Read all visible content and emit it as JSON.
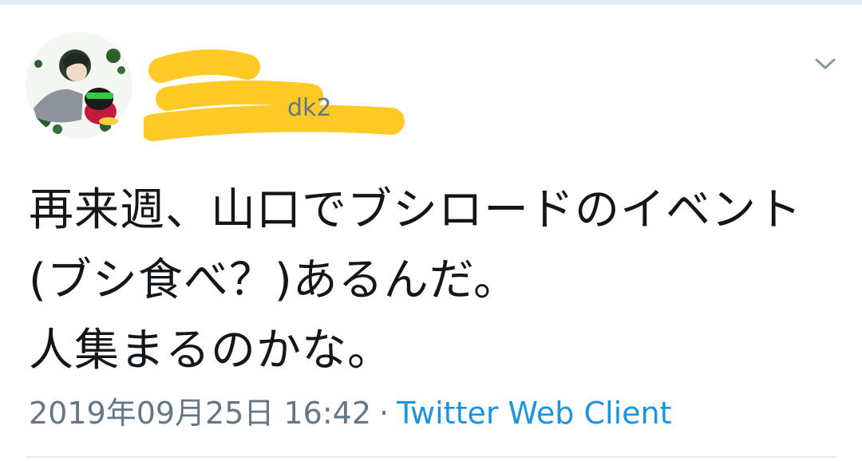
{
  "tweet": {
    "author": {
      "name_visible": "",
      "handle_visible": "dk2"
    },
    "text": "再来週、山口でブシロードのイベント(ブシ食べ？)あるんだ。\n人集まるのかな。",
    "timestamp": "2019年09月25日 16:42",
    "separator": "·",
    "client": "Twitter Web Client"
  },
  "icons": {
    "avatar": "user-avatar",
    "menu": "chevron-down-icon"
  },
  "colors": {
    "text": "#14171a",
    "muted": "#657786",
    "link": "#1b95e0",
    "redaction": "#ffc926",
    "divider": "#e6ecf0"
  }
}
